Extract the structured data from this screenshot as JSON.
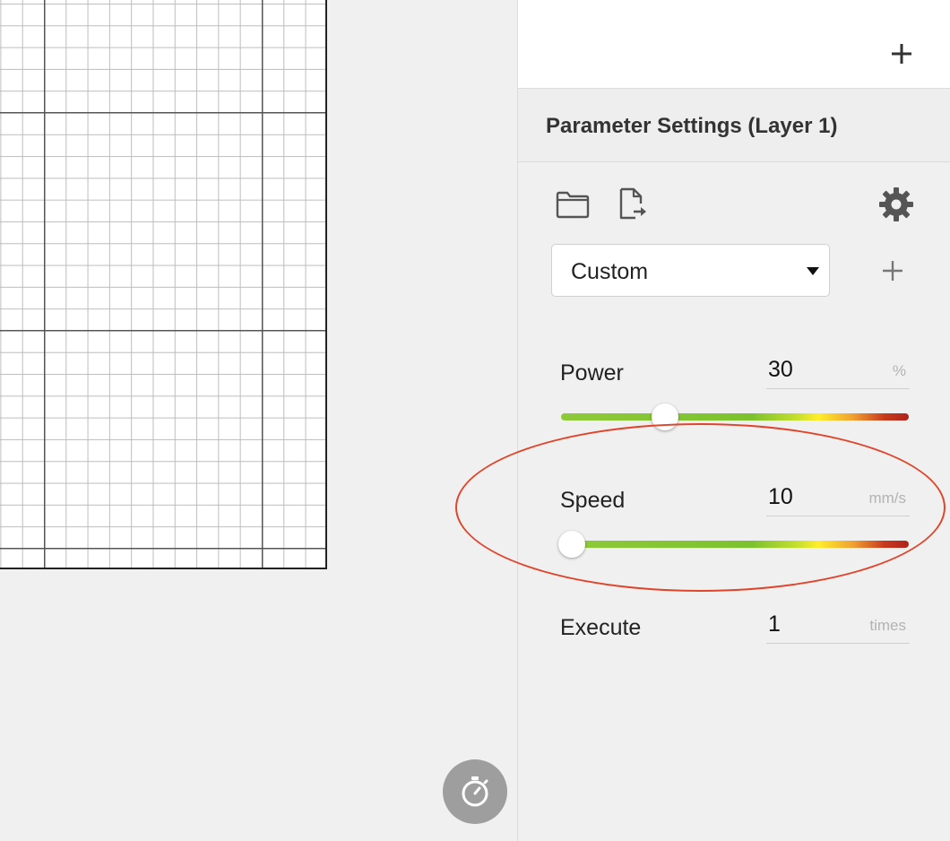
{
  "panel": {
    "add_layer_symbol": "+",
    "title": "Parameter Settings (Layer 1)"
  },
  "toolbar": {
    "icons": [
      "folder-icon",
      "export-file-icon",
      "gear-icon"
    ]
  },
  "preset": {
    "selected": "Custom",
    "add_symbol": "+"
  },
  "params": {
    "power": {
      "label": "Power",
      "value": "30",
      "unit": "%",
      "slider_fraction": 0.3
    },
    "speed": {
      "label": "Speed",
      "value": "10",
      "unit": "mm/s",
      "slider_fraction": 0.03
    },
    "execute": {
      "label": "Execute",
      "value": "1",
      "unit": "times"
    }
  },
  "colors": {
    "highlight": "#e0442a",
    "slider_low": "#7cc22e",
    "slider_mid": "#ffee2a",
    "slider_high": "#b0221a",
    "timer_button": "#9e9e9e"
  },
  "timer": {
    "icon": "stopwatch-icon"
  }
}
